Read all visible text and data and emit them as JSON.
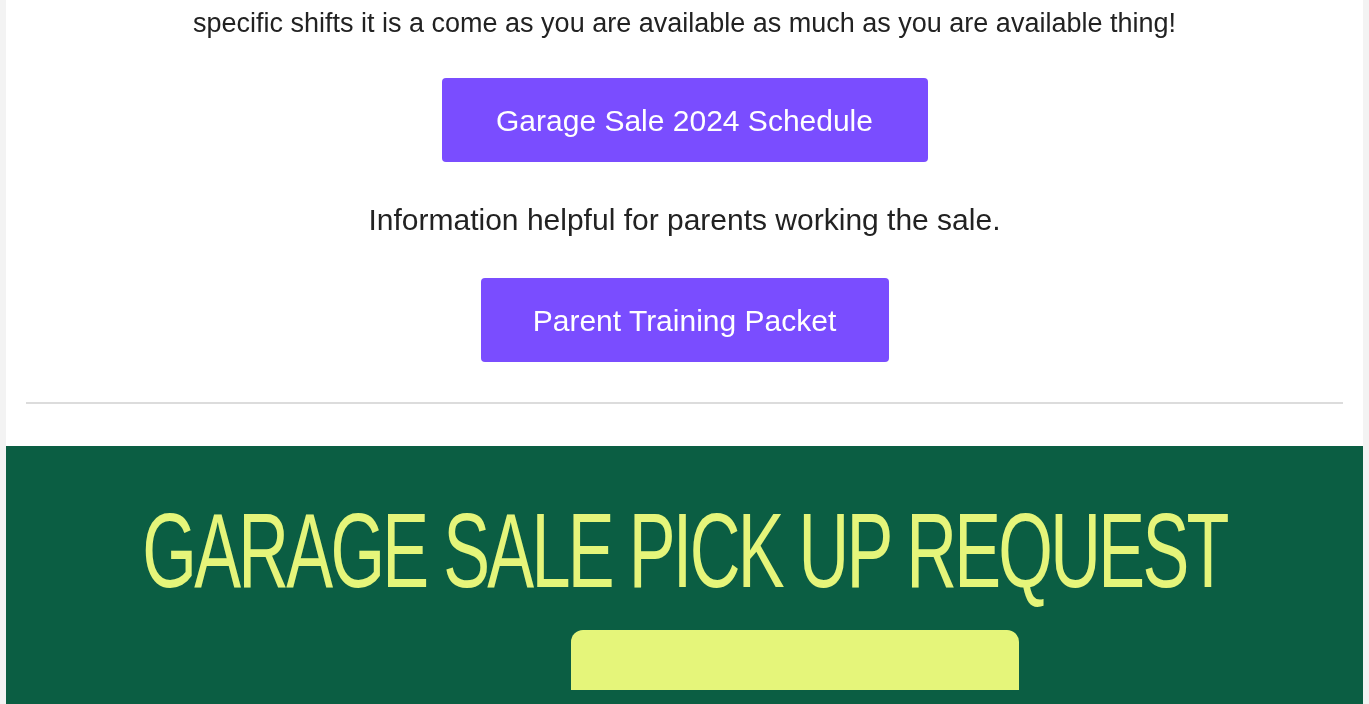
{
  "intro_text": "specific shifts it is a come as you are available as much as you are available thing!",
  "buttons": [
    {
      "label": "Garage Sale 2024 Schedule"
    }
  ],
  "info_text": "Information helpful for parents working the sale.",
  "buttons_2": [
    {
      "label": "Parent Training Packet"
    }
  ],
  "banner": {
    "title": "GARAGE SALE PICK UP REQUEST"
  }
}
